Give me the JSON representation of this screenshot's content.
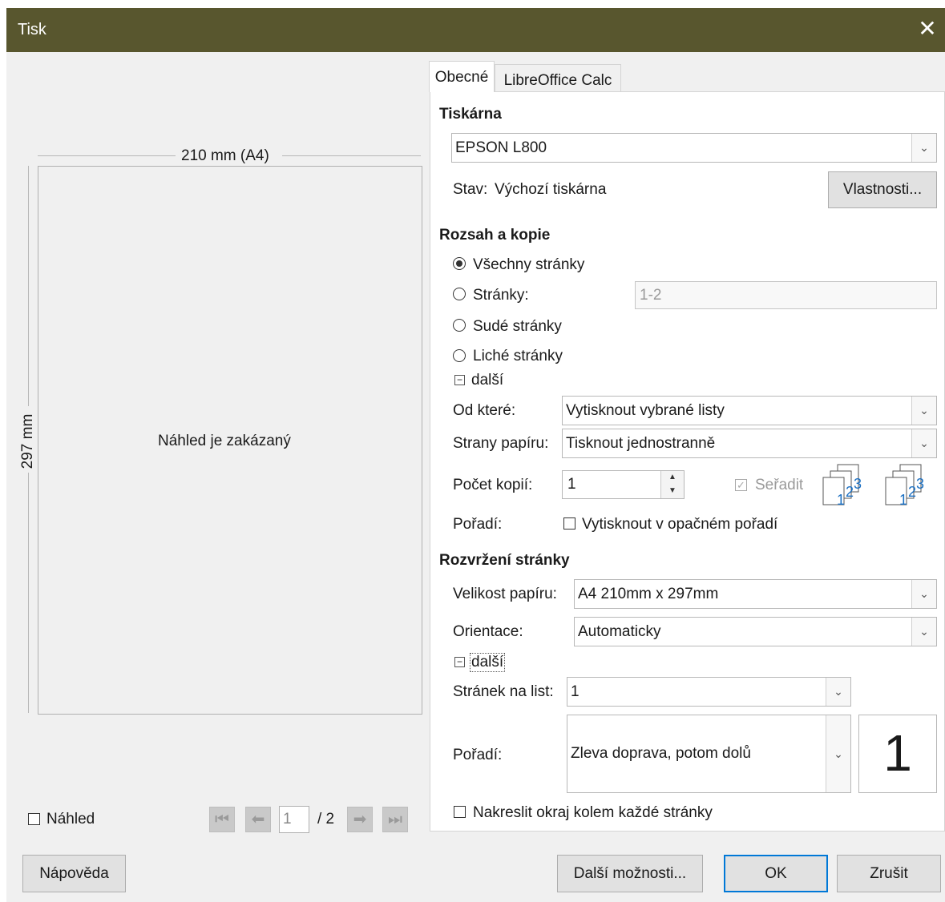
{
  "window": {
    "title": "Tisk",
    "close_glyph": "✕"
  },
  "preview": {
    "width_label": "210 mm (A4)",
    "height_label": "297 mm",
    "disabled_message": "Náhled je zakázaný",
    "show_preview_label": "Náhled",
    "show_preview_checked": false,
    "page_current": "1",
    "page_total": "/ 2"
  },
  "tabs": [
    {
      "label": "Obecné"
    },
    {
      "label": "LibreOffice Calc"
    }
  ],
  "printer": {
    "section_title": "Tiskárna",
    "selected": "EPSON L800",
    "status_label": "Stav:",
    "status_value": "Výchozí tiskárna",
    "properties_button": "Vlastnosti..."
  },
  "range": {
    "section_title": "Rozsah a kopie",
    "options": [
      {
        "label": "Všechny stránky",
        "selected": true
      },
      {
        "label": "Stránky:",
        "selected": false
      },
      {
        "label": "Sudé stránky",
        "selected": false
      },
      {
        "label": "Liché stránky",
        "selected": false
      }
    ],
    "pages_placeholder": "1-2",
    "more_label": "další",
    "from_which_label": "Od které:",
    "from_which_value": "Vytisknout vybrané listy",
    "paper_sides_label": "Strany papíru:",
    "paper_sides_value": "Tisknout jednostranně",
    "copies_label": "Počet kopií:",
    "copies_value": "1",
    "collate_label": "Seřadit",
    "collate_checked": true,
    "order_label": "Pořadí:",
    "reverse_label": "Vytisknout v opačném pořadí",
    "reverse_checked": false
  },
  "layout": {
    "section_title": "Rozvržení stránky",
    "paper_size_label": "Velikost papíru:",
    "paper_size_value": "A4 210mm x 297mm",
    "orientation_label": "Orientace:",
    "orientation_value": "Automaticky",
    "more_label": "další",
    "pages_per_sheet_label": "Stránek na list:",
    "pages_per_sheet_value": "1",
    "order_label": "Pořadí:",
    "order_value": "Zleva doprava, potom dolů",
    "order_preview": "1",
    "border_label": "Nakreslit okraj kolem každé stránky",
    "border_checked": false
  },
  "footer": {
    "help_button": "Nápověda",
    "more_options_button": "Další možnosti...",
    "ok_button": "OK",
    "cancel_button": "Zrušit"
  }
}
